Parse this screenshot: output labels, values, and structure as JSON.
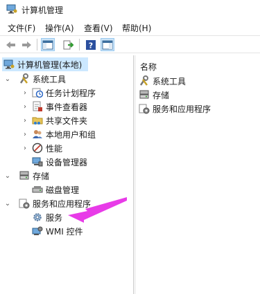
{
  "window": {
    "title": "计算机管理"
  },
  "menu": [
    {
      "label": "文件(F)"
    },
    {
      "label": "操作(A)"
    },
    {
      "label": "查看(V)"
    },
    {
      "label": "帮助(H)"
    }
  ],
  "tree": {
    "root": "计算机管理(本地)",
    "system_tools": "系统工具",
    "task_scheduler": "任务计划程序",
    "event_viewer": "事件查看器",
    "shared_folders": "共享文件夹",
    "local_users": "本地用户和组",
    "performance": "性能",
    "device_manager": "设备管理器",
    "storage": "存储",
    "disk_management": "磁盘管理",
    "services_apps": "服务和应用程序",
    "services": "服务",
    "wmi": "WMI 控件"
  },
  "right": {
    "column_header": "名称",
    "items": [
      {
        "label": "系统工具"
      },
      {
        "label": "存储"
      },
      {
        "label": "服务和应用程序"
      }
    ]
  },
  "colors": {
    "selection": "#cce8ff",
    "arrow": "#e83be8",
    "accent": "#0a64c8"
  }
}
